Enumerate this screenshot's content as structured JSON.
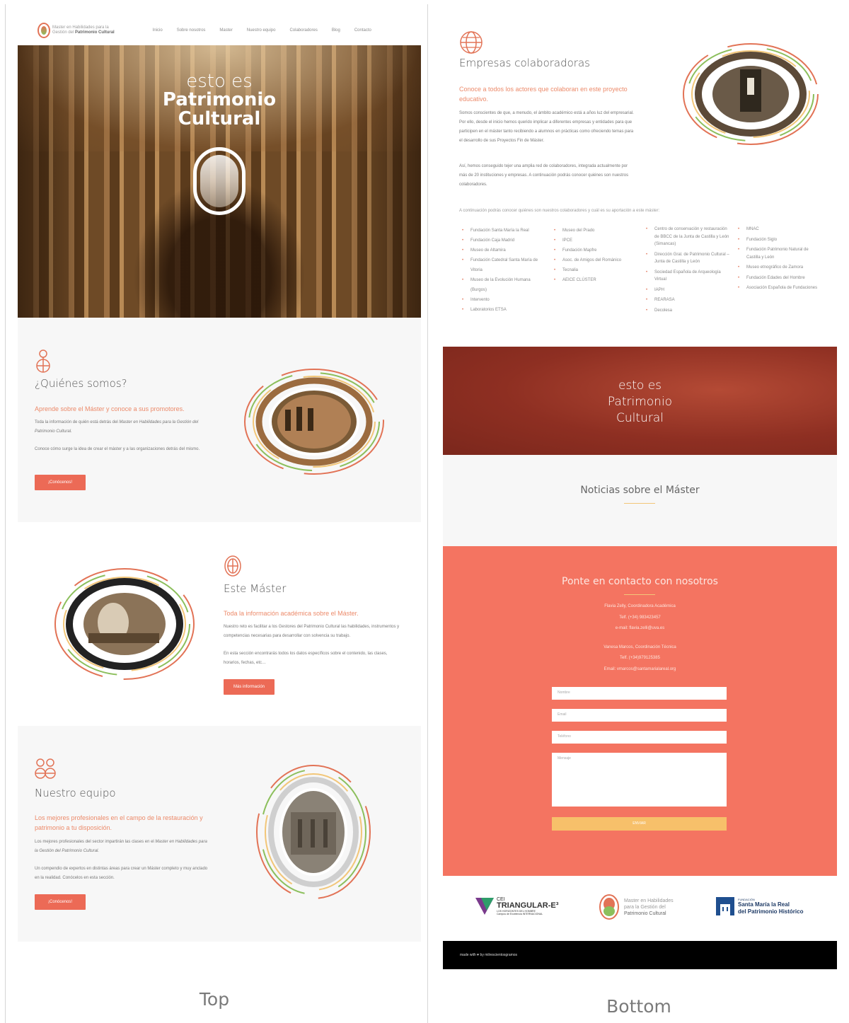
{
  "labels": {
    "left": "Top",
    "right": "Bottom"
  },
  "nav": {
    "brand_line1": "Master en Habilidades para la",
    "brand_line2_plain": "Gestión del ",
    "brand_line2_bold": "Patrimonio Cultural",
    "items": [
      "Inicio",
      "Sobre nosotros",
      "Master",
      "Nuestro equipo",
      "Colaboradores",
      "Blog",
      "Contacto"
    ]
  },
  "hero": {
    "line1": "esto es",
    "line2": "Patrimonio",
    "line3": "Cultural"
  },
  "quienes": {
    "title": "¿Quiénes somos?",
    "subtitle": "Aprende sobre el Máster y conoce a sus promotores.",
    "p1_a": "Toda la información de quién está detrás del ",
    "p1_em": "Master en Habilidades para la Gestión del Patrimonio Cultural.",
    "p2": "Conoce cómo surge la idea de crear el máster y a las organizaciones detrás del mismo.",
    "button": "¡Conócenos!"
  },
  "master": {
    "title": "Este Máster",
    "subtitle": "Toda la información académica sobre el Máster.",
    "p1": "Nuestro reto es facilitar a los Gestores del Patrimonio Cultural las habilidades, instrumentos y competencias necesarias para desarrollar con solvencia su trabajo.",
    "p2": "En esta sección encontrarás todos los datos específicos sobre el contenido, las clases, horarios, fechas, etc…",
    "button": "Más información"
  },
  "equipo": {
    "title": "Nuestro equipo",
    "subtitle": "Los mejores profesionales en el campo de la restauración y patrimonio a tu disposición.",
    "p1_a": "Los mejores profesionales del sector impartirán las clases en el ",
    "p1_em": "Master en Habilidades para la Gestión del Patrimonio Cultural.",
    "p2": "Un compendio de expertos en distintas áreas para crear un Máster completo y muy anclado en la realidad. Conócelos en esta sección.",
    "button": "¡Conócenos!"
  },
  "empresas": {
    "title": "Empresas colaboradoras",
    "subtitle": "Conoce a todos los actores que colaboran en este proyecto educativo.",
    "p1": "Somos conscientes de que, a menudo, el ámbito académico está a años luz del empresarial. Por ello, desde el inicio hemos querido implicar a diferentes empresas y entidades para que participen en el máster tanto recibiendo a alumnos en prácticas como ofreciendo temas para el desarrollo de sus Proyectos Fin de Máster.",
    "p2": "Así, hemos conseguido tejer una amplia red de colaboradores, integrada actualmente por más de 20 instituciones y empresas. A continuación podrás conocer quiénes son nuestros colaboradores.",
    "intro": "A continuación podrás conocer quiénes son nuestros colaboradores y cuál es su aportación a este máster:",
    "col1": [
      "Fundación Santa María la Real",
      "Fundación Caja Madrid",
      "Museo de Altamira",
      "Fundación Catedral Santa María de Vitoria",
      "Museo de la Evolución Humana (Burgos)",
      "Intervento",
      "Laboratorios ETSA"
    ],
    "col2": [
      "Museo del Prado",
      "IPCE",
      "Fundación Mapfre",
      "Asoc. de Amigos del Románico",
      "Tecnalia",
      "AEICE CLÚSTER"
    ],
    "col3": [
      "Centro de conservación y restauración de BBCC de la Junta de Castilla y León (Simancas)",
      "Dirección Gral. de Patrimonio Cultural – Junta de Castilla y León",
      "Sociedad Española de Arqueología Virtual",
      "IAPH",
      "REARASA",
      "Decolesa"
    ],
    "col4": [
      "MNAC",
      "Fundación Siglo",
      "Fundación Patrimonio Natural de Castilla y León",
      "Museo etnográfico de Zamora",
      "Fundación Edades del Hombre",
      "Asociación Española de Fundaciones"
    ]
  },
  "banner": {
    "line1": "esto es",
    "line2": "Patrimonio",
    "line3": "Cultural"
  },
  "news": {
    "title": "Noticias sobre el Máster"
  },
  "contact": {
    "title": "Ponte en contacto con nosotros",
    "l1": "Flavia Zelly, Coordinadora Académica",
    "l2": "Telf. (+34) 983423457",
    "l3": "e-mail: flavia.zelli@uva.es",
    "l4": "Vanesa Marcos, Coordinación Técnica",
    "l5": "Telf. (+34)979125385",
    "l6": "Email: vmarcos@santamarialareal.org",
    "name_ph": "Nombre",
    "email_ph": "Email",
    "phone_ph": "Teléfono",
    "message_ph": "Mensaje",
    "submit": "ENVIAR"
  },
  "logos": {
    "cei_top": "CEI",
    "cei_name": "TRIANGULAR-E³",
    "cei_sub": "LOS HORIZONTES DEL HOMBRE",
    "cei_sub2": "Campus de Excelencia INTERNACIONAL",
    "master_l1": "Master en Habilidades",
    "master_l2": "para la Gestión del",
    "master_l3": "Patrimonio Cultural",
    "fund_small": "FUNDACIÓN",
    "fund_l1": "Santa María la Real",
    "fund_l2": "del Patrimonio Histórico"
  },
  "footer": {
    "made": "made with ♥ by milrescientosgramos"
  }
}
